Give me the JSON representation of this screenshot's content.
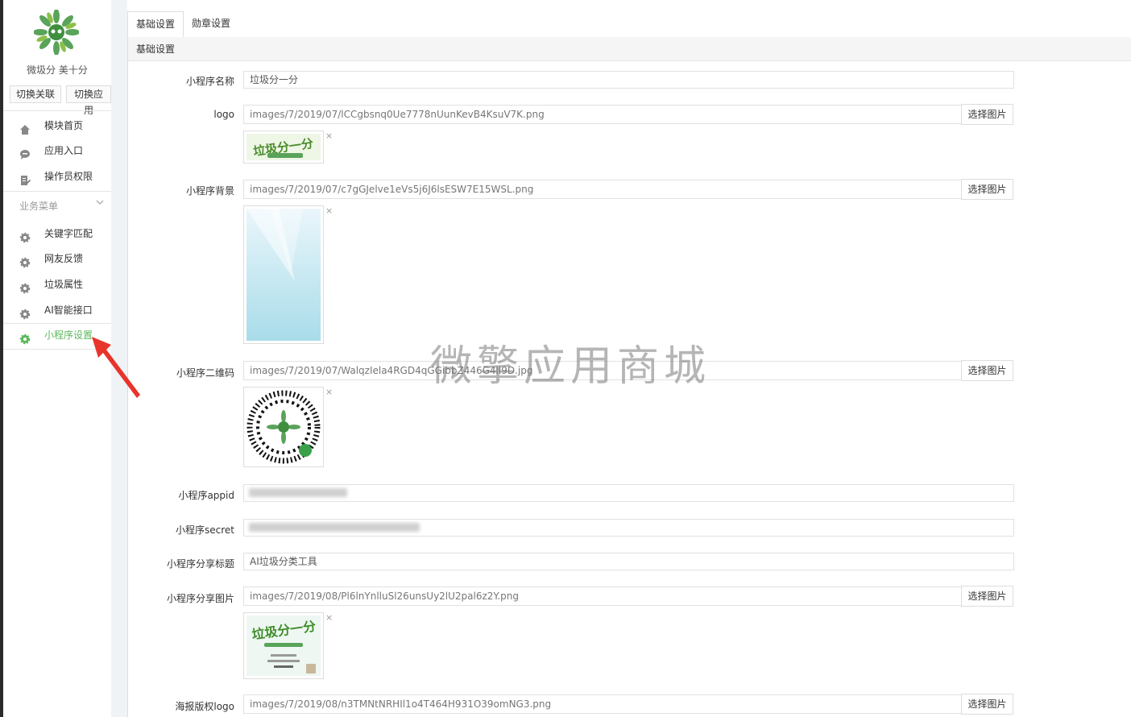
{
  "sidebar": {
    "app_name": "微圾分 美十分",
    "switch_account": "切换关联",
    "switch_app": "切换应用",
    "items": [
      {
        "label": "模块首页",
        "icon": "home-icon"
      },
      {
        "label": "应用入口",
        "icon": "chat-icon"
      },
      {
        "label": "操作员权限",
        "icon": "edit-icon"
      }
    ],
    "group_title": "业务菜单",
    "business_items": [
      {
        "label": "关键字匹配",
        "icon": "gear-icon"
      },
      {
        "label": "网友反馈",
        "icon": "gear-icon"
      },
      {
        "label": "垃圾属性",
        "icon": "gear-icon"
      },
      {
        "label": "AI智能接口",
        "icon": "gear-icon"
      },
      {
        "label": "小程序设置",
        "icon": "gear-icon",
        "active": true
      }
    ],
    "accent_color": "#5cb85c"
  },
  "tabs": [
    {
      "label": "基础设置",
      "active": true
    },
    {
      "label": "勋章设置",
      "active": false
    }
  ],
  "panel": {
    "title": "基础设置"
  },
  "form": {
    "name_label": "小程序名称",
    "name_value": "垃圾分一分",
    "logo_label": "logo",
    "logo_value": "images/7/2019/07/lCCgbsnq0Ue7778nUunKevB4KsuV7K.png",
    "bg_label": "小程序背景",
    "bg_value": "images/7/2019/07/c7gGJelve1eVs5j6J6lsESW7E15WSL.png",
    "qr_label": "小程序二维码",
    "qr_value": "images/7/2019/07/WalqzIela4RGD4qGGibbZ446G4ll9D.jpg",
    "appid_label": "小程序appid",
    "secret_label": "小程序secret",
    "share_title_label": "小程序分享标题",
    "share_title_value": "AI垃圾分类工具",
    "share_img_label": "小程序分享图片",
    "share_img_value": "images/7/2019/08/Pl6lnYnlluSl26unsUy2lU2pal6z2Y.png",
    "poster_label": "海报版权logo",
    "poster_value": "images/7/2019/08/n3TMNtNRHIl1o4T464H931O39omNG3.png",
    "pick_button": "选择图片",
    "remove_glyph": "×"
  },
  "watermark": "微擎应用商城"
}
